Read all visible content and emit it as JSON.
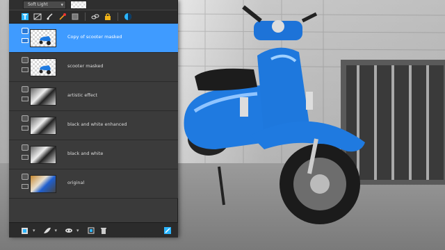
{
  "panel": {
    "blend_mode": "Soft Light",
    "toolbar_icons": [
      "text-layer-icon",
      "fill-layer-icon",
      "brush-layer-icon",
      "effects-icon",
      "layer-stack-icon",
      "link-icon",
      "lock-icon",
      "adjustment-icon"
    ],
    "layers": [
      {
        "name": "Copy of scooter masked",
        "thumb": "checker-scooter",
        "selected": true
      },
      {
        "name": "scooter masked",
        "thumb": "checker-scooter",
        "selected": false
      },
      {
        "name": "artistic effect",
        "thumb": "bw",
        "selected": false
      },
      {
        "name": "black and white enhanced",
        "thumb": "bw",
        "selected": false
      },
      {
        "name": "black and white",
        "thumb": "bw",
        "selected": false
      },
      {
        "name": "original",
        "thumb": "color",
        "selected": false
      }
    ],
    "bottom_icons": [
      "new-layer-icon",
      "mask-icon",
      "layer-group-icon",
      "merge-icon",
      "delete-icon",
      "settings-icon"
    ]
  },
  "colors": {
    "accent": "#3f9bff",
    "scooter_blue": "#1f7ae0",
    "panel_bg": "#3a3a3a"
  }
}
